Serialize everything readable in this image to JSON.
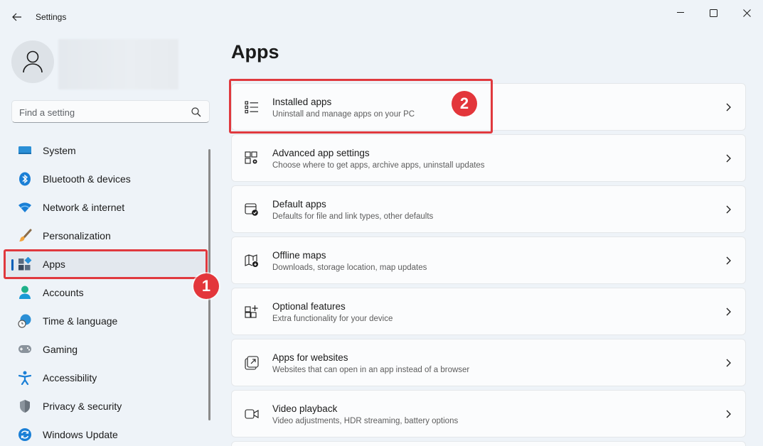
{
  "window": {
    "title": "Settings"
  },
  "search": {
    "placeholder": "Find a setting"
  },
  "nav": {
    "items": [
      {
        "label": "System",
        "icon": "monitor-icon"
      },
      {
        "label": "Bluetooth & devices",
        "icon": "bluetooth-icon"
      },
      {
        "label": "Network & internet",
        "icon": "wifi-icon"
      },
      {
        "label": "Personalization",
        "icon": "brush-icon"
      },
      {
        "label": "Apps",
        "icon": "apps-icon",
        "active": true
      },
      {
        "label": "Accounts",
        "icon": "person-icon"
      },
      {
        "label": "Time & language",
        "icon": "globe-clock-icon"
      },
      {
        "label": "Gaming",
        "icon": "gamepad-icon"
      },
      {
        "label": "Accessibility",
        "icon": "accessibility-icon"
      },
      {
        "label": "Privacy & security",
        "icon": "shield-icon"
      },
      {
        "label": "Windows Update",
        "icon": "update-icon"
      }
    ]
  },
  "main": {
    "title": "Apps",
    "cards": [
      {
        "title": "Installed apps",
        "subtitle": "Uninstall and manage apps on your PC",
        "icon": "list-icon"
      },
      {
        "title": "Advanced app settings",
        "subtitle": "Choose where to get apps, archive apps, uninstall updates",
        "icon": "app-settings-icon"
      },
      {
        "title": "Default apps",
        "subtitle": "Defaults for file and link types, other defaults",
        "icon": "default-apps-icon"
      },
      {
        "title": "Offline maps",
        "subtitle": "Downloads, storage location, map updates",
        "icon": "map-icon"
      },
      {
        "title": "Optional features",
        "subtitle": "Extra functionality for your device",
        "icon": "optional-features-icon"
      },
      {
        "title": "Apps for websites",
        "subtitle": "Websites that can open in an app instead of a browser",
        "icon": "open-external-icon"
      },
      {
        "title": "Video playback",
        "subtitle": "Video adjustments, HDR streaming, battery options",
        "icon": "video-icon"
      }
    ]
  },
  "annotations": {
    "step1": "1",
    "step2": "2",
    "color": "#e3363b"
  },
  "colors": {
    "accent": "#005fb8",
    "background": "#eef3f8"
  }
}
